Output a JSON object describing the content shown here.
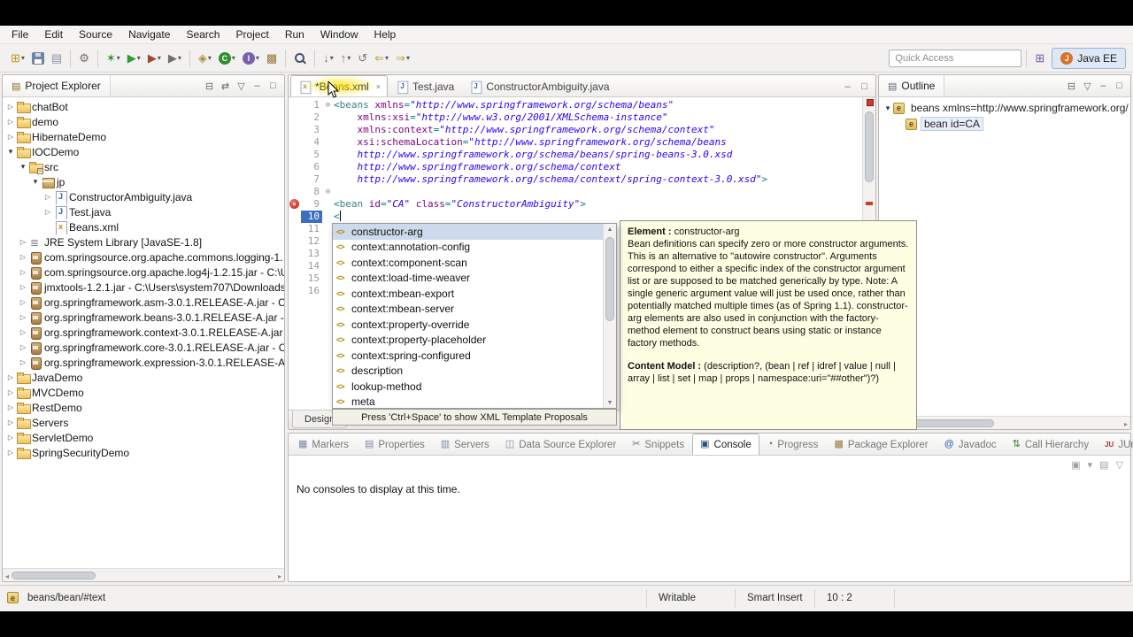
{
  "colors": {
    "accent": "#3d6fc0",
    "help_bg": "#fefee3",
    "error": "#d23a2a",
    "selection": "#cddaeb"
  },
  "ui_glyphs": {
    "expanded": "▾",
    "collapsed": "▷",
    "fold": "⊖",
    "error": "×",
    "close": "×",
    "dropdown": "▾",
    "element": "e",
    "xml_completion": "<>"
  },
  "menu": {
    "items": [
      "File",
      "Edit",
      "Source",
      "Navigate",
      "Search",
      "Project",
      "Run",
      "Window",
      "Help"
    ]
  },
  "toolbar": {
    "quick_access": "Quick Access",
    "perspective_label": "Java EE",
    "buttons": [
      {
        "name": "new-wizard-button",
        "glyph": "⊞",
        "color": "#b8962e",
        "dropdown": true
      },
      {
        "name": "save-button",
        "css": "floppy"
      },
      {
        "name": "print-button",
        "glyph": "▤",
        "color": "#8a94a2"
      },
      {
        "sep": true
      },
      {
        "name": "build-all-button",
        "glyph": "⚙",
        "color": "#6f6f6f"
      },
      {
        "sep": true
      },
      {
        "name": "debug-button",
        "glyph": "✶",
        "color": "#2f8f2f",
        "dropdown": true
      },
      {
        "name": "run-button",
        "glyph": "▶",
        "color": "#2e9b33",
        "dropdown": true
      },
      {
        "name": "coverage-button",
        "glyph": "▶",
        "color": "#9c4a2c",
        "dropdown": true
      },
      {
        "name": "external-tools-button",
        "glyph": "▶",
        "color": "#707070",
        "dropdown": true
      },
      {
        "sep": true
      },
      {
        "name": "new-web-wizard-button",
        "glyph": "◈",
        "color": "#b08c3a",
        "dropdown": true
      },
      {
        "name": "new-class-button",
        "badge": "C",
        "color": "#2f8f2f",
        "dropdown": true
      },
      {
        "name": "new-interface-button",
        "badge": "I",
        "color": "#7a5fae",
        "dropdown": true
      },
      {
        "name": "new-package-button",
        "glyph": "▩",
        "color": "#9a7a3a"
      },
      {
        "sep": true
      },
      {
        "name": "search-button",
        "css": "search"
      },
      {
        "sep": true
      },
      {
        "name": "next-annotation-button",
        "glyph": "↓",
        "color": "#777777",
        "dropdown": true
      },
      {
        "name": "previous-annotation-button",
        "glyph": "↑",
        "color": "#777777",
        "dropdown": true
      },
      {
        "name": "last-edit-location-button",
        "glyph": "↺",
        "color": "#777777"
      },
      {
        "name": "back-button",
        "glyph": "⇐",
        "color": "#c2a23c",
        "dropdown": true
      },
      {
        "name": "forward-button",
        "glyph": "⇒",
        "color": "#c2a23c",
        "dropdown": true
      }
    ],
    "open_perspective_glyph": "⊞"
  },
  "project_explorer": {
    "title": "Project Explorer",
    "icon_glyph": "▤",
    "tools": [
      {
        "name": "collapse-all-icon",
        "glyph": "⊟"
      },
      {
        "name": "link-with-editor-icon",
        "glyph": "⇄"
      },
      {
        "name": "view-menu-icon",
        "glyph": "▽"
      },
      {
        "name": "minimize-icon",
        "glyph": "–"
      },
      {
        "name": "maximize-icon",
        "glyph": "□"
      }
    ],
    "tree": [
      {
        "d": 0,
        "a": "c",
        "i": "folder",
        "l": "chatBot"
      },
      {
        "d": 0,
        "a": "c",
        "i": "folder",
        "l": "demo"
      },
      {
        "d": 0,
        "a": "c",
        "i": "folder",
        "l": "HibernateDemo"
      },
      {
        "d": 0,
        "a": "e",
        "i": "folder",
        "l": "IOCDemo"
      },
      {
        "d": 1,
        "a": "e",
        "i": "srcfolder",
        "l": "src"
      },
      {
        "d": 2,
        "a": "e",
        "i": "pkg",
        "l": "jp"
      },
      {
        "d": 3,
        "a": "c",
        "i": "jfile",
        "l": "ConstructorAmbiguity.java"
      },
      {
        "d": 3,
        "a": "c",
        "i": "jfile",
        "l": "Test.java"
      },
      {
        "d": 3,
        "a": "n",
        "i": "xmlfile",
        "l": "Beans.xml"
      },
      {
        "d": 1,
        "a": "c",
        "i": "lib",
        "l": "JRE System Library [JavaSE-1.8]"
      },
      {
        "d": 1,
        "a": "c",
        "i": "jar",
        "l": "com.springsource.org.apache.commons.logging-1."
      },
      {
        "d": 1,
        "a": "c",
        "i": "jar",
        "l": "com.springsource.org.apache.log4j-1.2.15.jar - C:\\U"
      },
      {
        "d": 1,
        "a": "c",
        "i": "jar",
        "l": "jmxtools-1.2.1.jar - C:\\Users\\system707\\Downloads'"
      },
      {
        "d": 1,
        "a": "c",
        "i": "jar",
        "l": "org.springframework.asm-3.0.1.RELEASE-A.jar - C:\\"
      },
      {
        "d": 1,
        "a": "c",
        "i": "jar",
        "l": "org.springframework.beans-3.0.1.RELEASE-A.jar - C"
      },
      {
        "d": 1,
        "a": "c",
        "i": "jar",
        "l": "org.springframework.context-3.0.1.RELEASE-A.jar -"
      },
      {
        "d": 1,
        "a": "c",
        "i": "jar",
        "l": "org.springframework.core-3.0.1.RELEASE-A.jar - C:"
      },
      {
        "d": 1,
        "a": "c",
        "i": "jar",
        "l": "org.springframework.expression-3.0.1.RELEASE-A.ja"
      },
      {
        "d": 0,
        "a": "c",
        "i": "folder",
        "l": "JavaDemo"
      },
      {
        "d": 0,
        "a": "c",
        "i": "folder",
        "l": "MVCDemo"
      },
      {
        "d": 0,
        "a": "c",
        "i": "folder",
        "l": "RestDemo"
      },
      {
        "d": 0,
        "a": "c",
        "i": "folder",
        "l": "Servers"
      },
      {
        "d": 0,
        "a": "c",
        "i": "folder",
        "l": "ServletDemo"
      },
      {
        "d": 0,
        "a": "c",
        "i": "folder",
        "l": "SpringSecurityDemo"
      }
    ]
  },
  "editor": {
    "tabs": [
      {
        "label": "*Beans.xml",
        "icon": "xmlfile",
        "active": true
      },
      {
        "label": "Test.java",
        "icon": "jfile"
      },
      {
        "label": "ConstructorAmbiguity.java",
        "icon": "jfile"
      }
    ],
    "window_buttons": [
      {
        "name": "minimize-icon",
        "glyph": "–"
      },
      {
        "name": "maximize-icon",
        "glyph": "□"
      }
    ],
    "bottom_tabs": [
      "Design"
    ],
    "hint": "Press 'Ctrl+Space' to show XML Template Proposals",
    "lines": [
      {
        "n": 1,
        "fold": true,
        "tk": [
          [
            "d",
            "<"
          ],
          [
            "t",
            "beans"
          ],
          [
            "p",
            " "
          ],
          [
            "a",
            "xmlns"
          ],
          [
            "d",
            "="
          ],
          [
            "v",
            "\"http://www.springframework.org/schema/beans\""
          ]
        ]
      },
      {
        "n": 2,
        "tk": [
          [
            "p",
            "    "
          ],
          [
            "a",
            "xmlns:xsi"
          ],
          [
            "d",
            "="
          ],
          [
            "v",
            "\"http://www.w3.org/2001/XMLSchema-instance\""
          ]
        ]
      },
      {
        "n": 3,
        "tk": [
          [
            "p",
            "    "
          ],
          [
            "a",
            "xmlns:context"
          ],
          [
            "d",
            "="
          ],
          [
            "v",
            "\"http://www.springframework.org/schema/context\""
          ]
        ]
      },
      {
        "n": 4,
        "tk": [
          [
            "p",
            "    "
          ],
          [
            "a",
            "xsi:schemaLocation"
          ],
          [
            "d",
            "="
          ],
          [
            "v",
            "\"http://www.springframework.org/schema/beans"
          ]
        ]
      },
      {
        "n": 5,
        "tk": [
          [
            "v",
            "    http://www.springframework.org/schema/beans/spring-beans-3.0.xsd"
          ]
        ]
      },
      {
        "n": 6,
        "tk": [
          [
            "v",
            "    http://www.springframework.org/schema/context"
          ]
        ]
      },
      {
        "n": 7,
        "tk": [
          [
            "v",
            "    http://www.springframework.org/schema/context/spring-context-3.0.xsd\""
          ],
          [
            "d",
            ">"
          ]
        ]
      },
      {
        "n": 8,
        "fold": true,
        "tk": []
      },
      {
        "n": 9,
        "error": true,
        "tk": [
          [
            "d",
            "<"
          ],
          [
            "t",
            "bean"
          ],
          [
            "p",
            " "
          ],
          [
            "a",
            "id"
          ],
          [
            "d",
            "="
          ],
          [
            "v",
            "\"CA\""
          ],
          [
            "p",
            " "
          ],
          [
            "a",
            "class"
          ],
          [
            "d",
            "="
          ],
          [
            "v",
            "\"ConstructorAmbiguity\""
          ],
          [
            "d",
            ">"
          ]
        ]
      },
      {
        "n": 10,
        "current": true,
        "tk": [
          [
            "d",
            "<"
          ],
          [
            "caret",
            ""
          ]
        ]
      },
      {
        "n": 11,
        "tk": []
      },
      {
        "n": 12,
        "tk": []
      },
      {
        "n": 13,
        "tk": []
      },
      {
        "n": 14,
        "tk": []
      },
      {
        "n": 15,
        "tk": []
      },
      {
        "n": 16,
        "tk": []
      }
    ]
  },
  "content_assist": {
    "items": [
      {
        "label": "constructor-arg",
        "selected": true
      },
      {
        "label": "context:annotation-config"
      },
      {
        "label": "context:component-scan"
      },
      {
        "label": "context:load-time-weaver"
      },
      {
        "label": "context:mbean-export"
      },
      {
        "label": "context:mbean-server"
      },
      {
        "label": "context:property-override"
      },
      {
        "label": "context:property-placeholder"
      },
      {
        "label": "context:spring-configured"
      },
      {
        "label": "description"
      },
      {
        "label": "lookup-method"
      },
      {
        "label": "meta"
      }
    ]
  },
  "help_popup": {
    "title_label": "Element :",
    "title_value": "constructor-arg",
    "body": "Bean definitions can specify zero or more constructor arguments. This is an alternative to \"autowire constructor\". Arguments correspond to either a specific index of the constructor argument list or are supposed to be matched generically by type. Note: A single generic argument value will just be used once, rather than potentially matched multiple times (as of Spring 1.1). constructor-arg elements are also used in conjunction with the factory-method element to construct beans using static or instance factory methods.",
    "model_label": "Content Model :",
    "model_value": "(description?, (bean | ref | idref | value | null | array | list | set | map | props | namespace:uri=\"##other\")?)"
  },
  "outline": {
    "title": "Outline",
    "icon_glyph": "▤",
    "tools": [
      {
        "name": "collapse-all-icon",
        "glyph": "⊟"
      },
      {
        "name": "view-menu-icon",
        "glyph": "▽"
      },
      {
        "name": "minimize-icon",
        "glyph": "–"
      },
      {
        "name": "maximize-icon",
        "glyph": "□"
      }
    ],
    "items": [
      {
        "depth": 0,
        "a": "e",
        "label": "beans xmlns=http://www.springframework.org/"
      },
      {
        "depth": 1,
        "a": "n",
        "label": "bean id=CA",
        "selected": true
      }
    ]
  },
  "bottom_panel": {
    "tabs": [
      {
        "label": "Markers",
        "icon": "markers-icon",
        "glyph": "▦",
        "color": "#7a8aa0"
      },
      {
        "label": "Properties",
        "icon": "properties-icon",
        "glyph": "▤",
        "color": "#7a8aa0"
      },
      {
        "label": "Servers",
        "icon": "servers-icon",
        "glyph": "▥",
        "color": "#7a8aa0"
      },
      {
        "label": "Data Source Explorer",
        "icon": "data-source-explorer-icon",
        "glyph": "◫",
        "color": "#7a8aa0"
      },
      {
        "label": "Snippets",
        "icon": "snippets-icon",
        "glyph": "✂",
        "color": "#667088"
      },
      {
        "label": "Console",
        "icon": "console-icon",
        "glyph": "▣",
        "color": "#28527a",
        "active": true
      },
      {
        "label": "Progress",
        "icon": "progress-icon",
        "glyph": "◔",
        "color": "#3a7a3a"
      },
      {
        "label": "Package Explorer",
        "icon": "package-explorer-icon",
        "glyph": "▩",
        "color": "#9a7a3a"
      },
      {
        "label": "Javadoc",
        "icon": "javadoc-icon",
        "glyph": "@",
        "color": "#2a5db0"
      },
      {
        "label": "Call Hierarchy",
        "icon": "call-hierarchy-icon",
        "glyph": "⇅",
        "color": "#3a7a3a"
      },
      {
        "label": "JUnit",
        "icon": "junit-icon",
        "glyph": "JU",
        "color": "#a03a3a"
      }
    ],
    "window_buttons": [
      {
        "name": "minimize-icon",
        "glyph": "–"
      },
      {
        "name": "maximize-icon",
        "glyph": "□"
      }
    ],
    "tools": [
      {
        "name": "open-console-icon",
        "glyph": "▣"
      },
      {
        "name": "open-console-menu-icon",
        "glyph": "▾"
      },
      {
        "name": "display-selected-console-icon",
        "glyph": "▤"
      },
      {
        "name": "view-menu-icon",
        "glyph": "▽"
      }
    ],
    "message": "No consoles to display at this time."
  },
  "status_bar": {
    "path": "beans/bean/#text",
    "writable": "Writable",
    "mode": "Smart Insert",
    "position": "10 : 2"
  }
}
